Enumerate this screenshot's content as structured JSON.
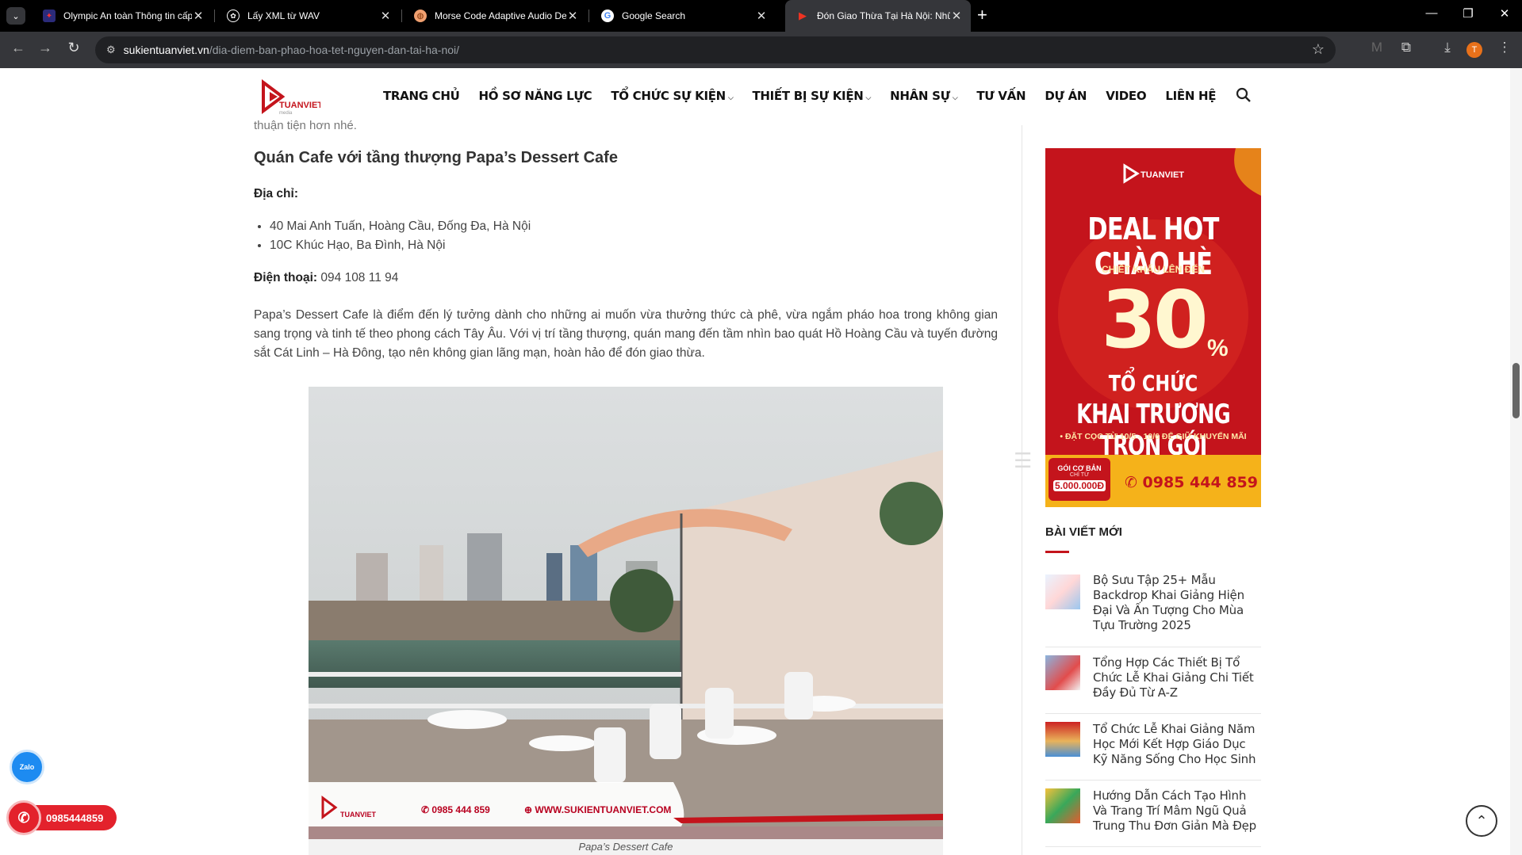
{
  "browser": {
    "tabs": [
      {
        "title": "Olympic An toàn Thông tin cấp",
        "favicon": "flag-icon",
        "active": false
      },
      {
        "title": "Lấy XML từ WAV",
        "favicon": "openai-icon",
        "active": false
      },
      {
        "title": "Morse Code Adaptive Audio De",
        "favicon": "globe-icon",
        "active": false
      },
      {
        "title": "Google Search",
        "favicon": "google-icon",
        "active": false
      },
      {
        "title": "Đón Giao Thừa Tại Hà Nội: Nhữ",
        "favicon": "site-icon",
        "active": true
      }
    ],
    "url_host": "sukientuanviet.vn",
    "url_path": "/dia-diem-ban-phao-hoa-tet-nguyen-dan-tai-ha-noi/",
    "profile_initial": "T"
  },
  "site": {
    "logo_text": "TUANVIET",
    "logo_sub": "media",
    "nav": [
      {
        "label": "TRANG CHỦ",
        "has_caret": false
      },
      {
        "label": "HỒ SƠ NĂNG LỰC",
        "has_caret": false
      },
      {
        "label": "TỔ CHỨC SỰ KIỆN",
        "has_caret": true
      },
      {
        "label": "THIẾT BỊ SỰ KIỆN",
        "has_caret": true
      },
      {
        "label": "NHÂN SỰ",
        "has_caret": true
      },
      {
        "label": "TƯ VẤN",
        "has_caret": false
      },
      {
        "label": "DỰ ÁN",
        "has_caret": false
      },
      {
        "label": "VIDEO",
        "has_caret": false
      },
      {
        "label": "LIÊN HỆ",
        "has_caret": false
      }
    ]
  },
  "article": {
    "cut_text": "thuận tiện hơn nhé.",
    "heading": "Quán Cafe với tầng thượng Papa’s Dessert Cafe",
    "address_label": "Địa chỉ:",
    "addresses": [
      "40 Mai Anh Tuấn, Hoàng Cầu, Đống Đa, Hà Nội",
      "10C Khúc Hạo, Ba Đình, Hà Nội"
    ],
    "phone_label": "Điện thoại:",
    "phone_value": " 094 108 11 94",
    "description": "Papa’s Dessert Cafe là điểm đến lý tưởng dành cho những ai muốn vừa thưởng thức cà phê, vừa ngắm pháo hoa trong không gian sang trọng và tinh tế theo phong cách Tây Âu. Với vị trí tầng thượng, quán mang đến tầm nhìn bao quát Hồ Hoàng Cầu và tuyến đường sắt Cát Linh – Hà Đông, tạo nên không gian lãng mạn, hoàn hảo để đón giao thừa.",
    "photo_banner_phone": "0985 444 859",
    "photo_banner_web": "WWW.SUKIENTUANVIET.COM",
    "photo_logo_text": "TUANVIET",
    "caption": "Papa’s Dessert Cafe"
  },
  "sidebar": {
    "ad": {
      "brand": "TUANVIET",
      "headline": "DEAL HOT CHÀO HÈ",
      "discount_label": "CHIẾT KHẤU LÊN ĐẾN",
      "discount_value": "30",
      "discount_unit": "%",
      "line1": "TỔ CHỨC",
      "line2": "KHAI TRƯƠNG TRỌN GÓI",
      "deposit_note": "• ĐẶT CỌC TỪ 10/5 - 10/6 ĐỂ GIỮ KHUYẾN MÃI",
      "package_label": "GÓI CƠ BẢN",
      "package_sub": "CHỈ TỪ",
      "package_price": "5.000.000Đ",
      "hotline": "0985 444 859"
    },
    "recent_heading": "BÀI VIẾT MỚI",
    "posts": [
      {
        "title": "Bộ Sưu Tập 25+ Mẫu Backdrop Khai Giảng Hiện Đại Và Ấn Tượng Cho Mùa Tựu Trường 2025"
      },
      {
        "title": "Tổng Hợp Các Thiết Bị Tổ Chức Lễ Khai Giảng Chi Tiết Đầy Đủ Từ A-Z"
      },
      {
        "title": "Tổ Chức Lễ Khai Giảng Năm Học Mới Kết Hợp Giáo Dục Kỹ Năng Sống Cho Học Sinh"
      },
      {
        "title": "Hướng Dẫn Cách Tạo Hình Và Trang Trí Mâm Ngũ Quả Trung Thu Đơn Giản Mà Đẹp"
      }
    ]
  },
  "floating": {
    "zalo_label": "Zalo",
    "call_number": "0985444859"
  },
  "colors": {
    "brand_red": "#c4141c",
    "chrome_bg": "#35363a",
    "tabbar_bg": "#000000"
  }
}
